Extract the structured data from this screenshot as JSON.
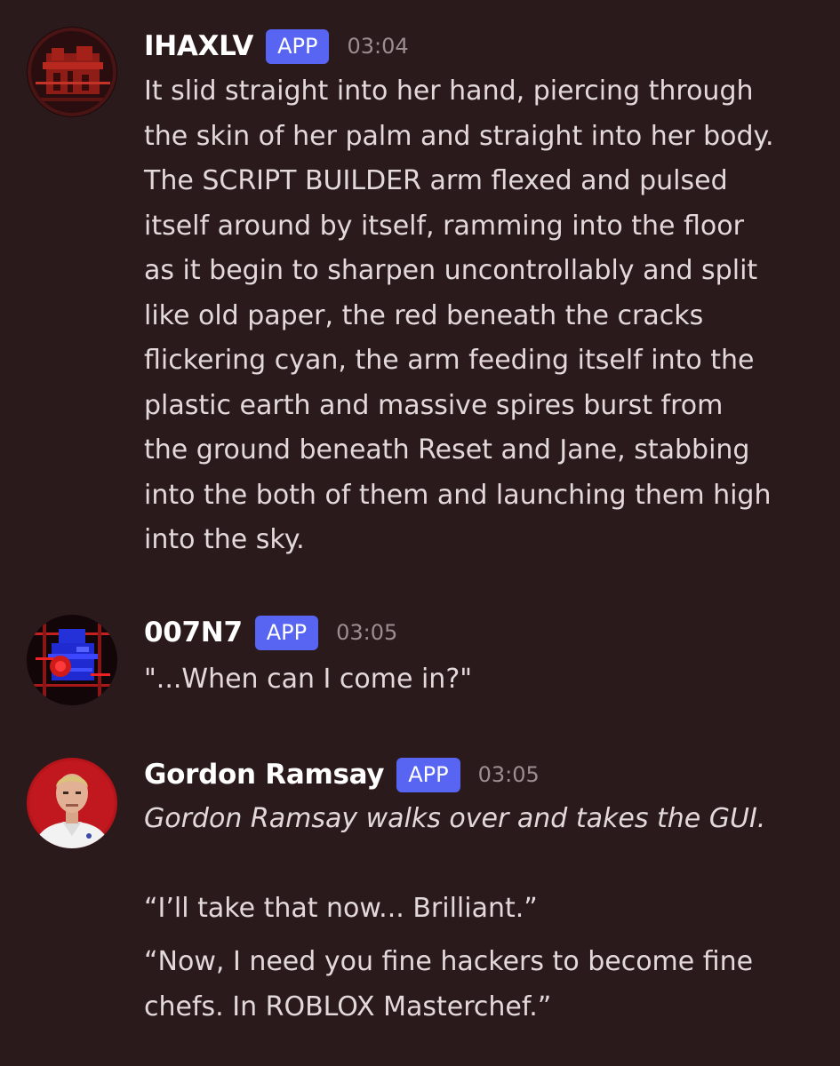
{
  "colors": {
    "background": "#2a1a1c",
    "badge": "#5865f2",
    "username": "#ffffff",
    "timestamp": "#9b8e90",
    "text": "#e3d9da"
  },
  "messages": [
    {
      "author": "IHAXLV",
      "badge": "APP",
      "time": "03:04",
      "avatar_icon": "red-glitch-avatar-icon",
      "lines": [
        "It slid straight into her hand, piercing through",
        "the skin of her palm and straight into her body.",
        "The SCRIPT BUILDER arm flexed and pulsed",
        "itself around by itself, ramming into the floor",
        "as it begin to sharpen uncontrollably and split",
        "like old paper, the red beneath the cracks",
        "flickering cyan, the arm feeding itself into the",
        "plastic earth and massive spires burst from",
        "the ground beneath Reset and Jane, stabbing",
        "into the both of them and launching them high",
        "into the sky."
      ]
    },
    {
      "author": "007N7",
      "badge": "APP",
      "time": "03:05",
      "avatar_icon": "blue-glitch-avatar-icon",
      "lines": [
        "\"...When can I come in?\""
      ]
    },
    {
      "author": "Gordon Ramsay",
      "badge": "APP",
      "time": "03:05",
      "avatar_icon": "chef-portrait-avatar-icon",
      "italic_line": "Gordon Ramsay walks over and takes the GUI.",
      "line_quote1": "“I’ll take that now... Brilliant.”",
      "lines_quote2": [
        "“Now, I need you fine hackers to become fine",
        "chefs. In ROBLOX Masterchef.”"
      ]
    }
  ]
}
